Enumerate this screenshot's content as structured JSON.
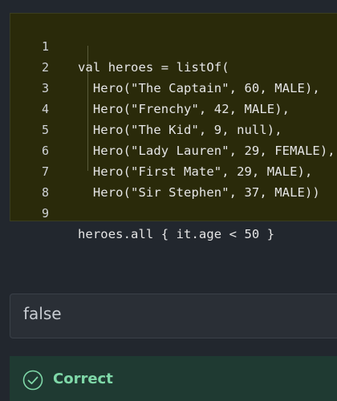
{
  "code": {
    "lines": [
      {
        "no": "1",
        "text": "val heroes = listOf("
      },
      {
        "no": "2",
        "text": "  Hero(\"The Captain\", 60, MALE),"
      },
      {
        "no": "3",
        "text": "  Hero(\"Frenchy\", 42, MALE),"
      },
      {
        "no": "4",
        "text": "  Hero(\"The Kid\", 9, null),"
      },
      {
        "no": "5",
        "text": "  Hero(\"Lady Lauren\", 29, FEMALE),"
      },
      {
        "no": "6",
        "text": "  Hero(\"First Mate\", 29, MALE),"
      },
      {
        "no": "7",
        "text": "  Hero(\"Sir Stephen\", 37, MALE))"
      },
      {
        "no": "8",
        "text": ""
      },
      {
        "no": "9",
        "text": "heroes.all { it.age < 50 }"
      }
    ]
  },
  "answer": {
    "value": "false"
  },
  "feedback": {
    "label": "Correct",
    "icon": "check-circle-icon",
    "color": "#7fd8a8"
  }
}
